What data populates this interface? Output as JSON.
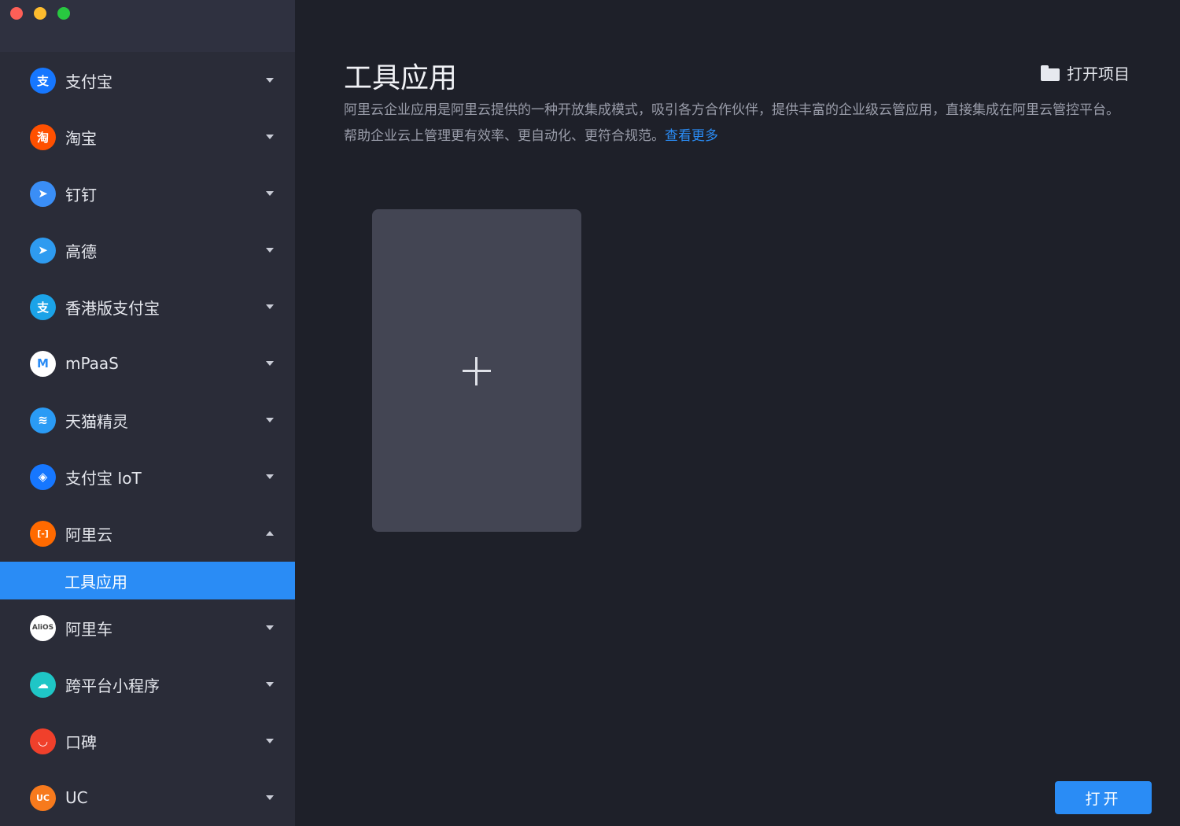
{
  "sidebar": {
    "items": [
      {
        "label": "支付宝",
        "icon": "alipay-icon",
        "glyph": "支",
        "color": "#1677ff",
        "expanded": false
      },
      {
        "label": "淘宝",
        "icon": "taobao-icon",
        "glyph": "淘",
        "color": "#ff5000",
        "expanded": false
      },
      {
        "label": "钉钉",
        "icon": "dingtalk-icon",
        "glyph": "➤",
        "color": "#3a8ef6",
        "expanded": false
      },
      {
        "label": "高德",
        "icon": "amap-icon",
        "glyph": "➤",
        "color": "#2e9bf0",
        "expanded": false
      },
      {
        "label": "香港版支付宝",
        "icon": "alipay-hk-icon",
        "glyph": "支",
        "color": "#1ba3e8",
        "expanded": false
      },
      {
        "label": "mPaaS",
        "icon": "mpaas-icon",
        "glyph": "M",
        "color": "#ffffff",
        "expanded": false
      },
      {
        "label": "天猫精灵",
        "icon": "tmall-genie-icon",
        "glyph": "≋",
        "color": "#2a9bf5",
        "expanded": false
      },
      {
        "label": "支付宝 IoT",
        "icon": "alipay-iot-icon",
        "glyph": "◈",
        "color": "#1677ff",
        "expanded": false
      },
      {
        "label": "阿里云",
        "icon": "aliyun-icon",
        "glyph": "[-]",
        "color": "#ff6a00",
        "expanded": true
      },
      {
        "label": "阿里车",
        "icon": "alios-icon",
        "glyph": "AliOS",
        "color": "#ffffff",
        "expanded": false
      },
      {
        "label": "跨平台小程序",
        "icon": "cross-platform-icon",
        "glyph": "☁",
        "color": "#1fc6c6",
        "expanded": false
      },
      {
        "label": "口碑",
        "icon": "koubei-icon",
        "glyph": "◡",
        "color": "#f0402b",
        "expanded": false
      },
      {
        "label": "UC",
        "icon": "uc-icon",
        "glyph": "UC",
        "color": "#f77a1d",
        "expanded": false
      }
    ],
    "active_sub_item": "工具应用"
  },
  "main": {
    "title": "工具应用",
    "open_project_label": "打开项目",
    "description": "阿里云企业应用是阿里云提供的一种开放集成模式，吸引各方合作伙伴，提供丰富的企业级云管应用，直接集成在阿里云管控平台。帮助企业云上管理更有效率、更自动化、更符合规范。",
    "description_link": "查看更多",
    "open_button_label": "打开"
  },
  "colors": {
    "accent": "#2a8cf5",
    "background": "#1e2029",
    "sidebar": "#2a2c38",
    "card": "#434553"
  }
}
